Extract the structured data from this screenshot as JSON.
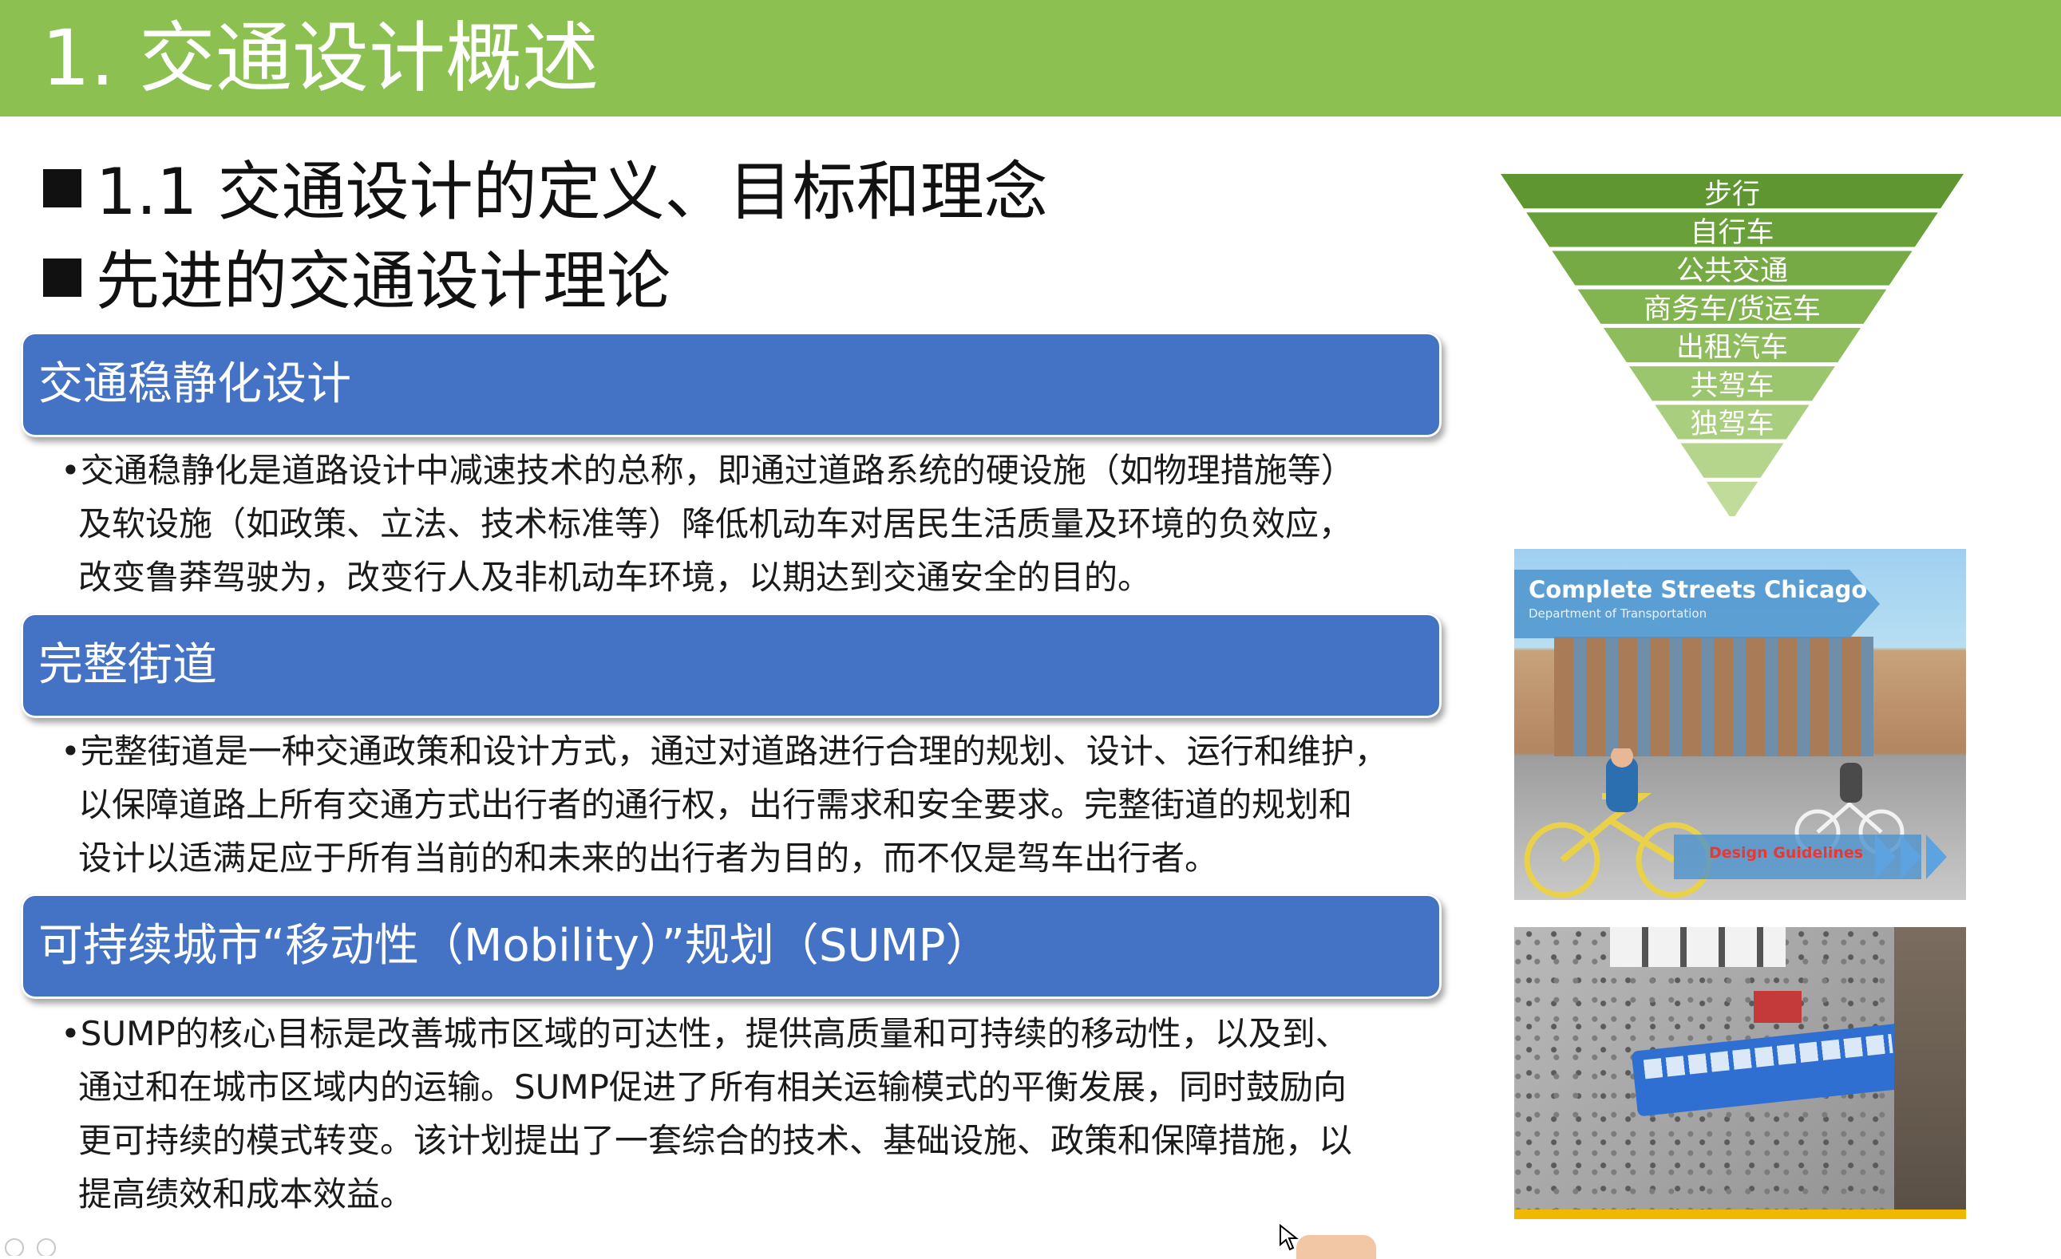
{
  "slide": {
    "title": "1. 交通设计概述",
    "headings": [
      "1.1 交通设计的定义、目标和理念",
      "先进的交通设计理论"
    ]
  },
  "sections": [
    {
      "title": "交通稳静化设计",
      "lines": [
        "•交通稳静化是道路设计中减速技术的总称，即通过道路系统的硬设施（如物理措施等）",
        "及软设施（如政策、立法、技术标准等）降低机动车对居民生活质量及环境的负效应，",
        "改变鲁莽驾驶为，改变行人及非机动车环境，以期达到交通安全的目的。"
      ]
    },
    {
      "title": "完整街道",
      "lines": [
        "•完整街道是一种交通政策和设计方式，通过对道路进行合理的规划、设计、运行和维护，",
        "以保障道路上所有交通方式出行者的通行权，出行需求和安全要求。完整街道的规划和",
        "设计以适满足应于所有当前的和未来的出行者为目的，而不仅是驾车出行者。"
      ]
    },
    {
      "title": "可持续城市“移动性（Mobility）”规划（SUMP）",
      "lines": [
        "•SUMP的核心目标是改善城市区域的可达性，提供高质量和可持续的移动性，以及到、",
        "通过和在城市区域内的运输。SUMP促进了所有相关运输模式的平衡发展，同时鼓励向",
        "更可持续的模式转变。该计划提出了一套综合的技术、基础设施、政策和保障措施，以",
        "提高绩效和成本效益。"
      ]
    }
  ],
  "pyramid": {
    "levels": [
      "步行",
      "自行车",
      "公共交通",
      "商务车/货运车",
      "出租汽车",
      "共驾车",
      "独驾车"
    ],
    "colors": [
      "#5f9632",
      "#6aa03a",
      "#76aa44",
      "#82b450",
      "#8fbd5e",
      "#9cc66d",
      "#a9ce7d",
      "#b5d58c",
      "#c0db9a"
    ]
  },
  "images": {
    "complete_streets": {
      "title": "Complete Streets Chicago",
      "subtitle": "Department of Transportation",
      "guide": "Design Guidelines"
    }
  },
  "colors": {
    "title_bar": "#8cc152",
    "section_bar": "#4472c4"
  }
}
